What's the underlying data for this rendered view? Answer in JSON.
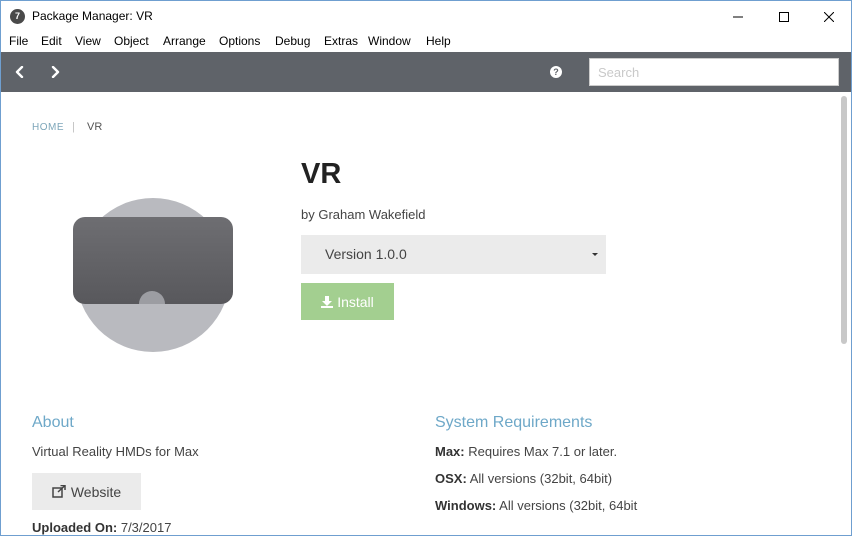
{
  "window": {
    "title": "Package Manager: VR",
    "icon_glyph": "7"
  },
  "menu": {
    "items": [
      "File",
      "Edit",
      "View",
      "Object",
      "Arrange",
      "Options",
      "Debug",
      "Extras",
      "Window",
      "Help"
    ]
  },
  "toolbar": {
    "back_icon": "chevron-left-icon",
    "forward_icon": "chevron-right-icon",
    "help_glyph": "?",
    "search_placeholder": "Search"
  },
  "breadcrumb": {
    "home": "HOME",
    "separator": "|",
    "current": "VR"
  },
  "package": {
    "title": "VR",
    "author": "by Graham Wakefield",
    "version_label": "Version 1.0.0",
    "install_label": "Install"
  },
  "about": {
    "heading": "About",
    "description": "Virtual Reality HMDs for Max",
    "website_label": "Website",
    "uploaded_label": "Uploaded On:",
    "uploaded_value": "7/3/2017"
  },
  "system_requirements": {
    "heading": "System Requirements",
    "rows": [
      {
        "label": "Max:",
        "value": "Requires Max 7.1 or later."
      },
      {
        "label": "OSX:",
        "value": "All versions (32bit, 64bit)"
      },
      {
        "label": "Windows:",
        "value": "All versions (32bit, 64bit"
      }
    ]
  },
  "colors": {
    "toolbar_bg": "#5f6369",
    "accent_heading": "#6ea8c8",
    "install_bg": "#a3cf90",
    "button_gray": "#ebebeb"
  }
}
